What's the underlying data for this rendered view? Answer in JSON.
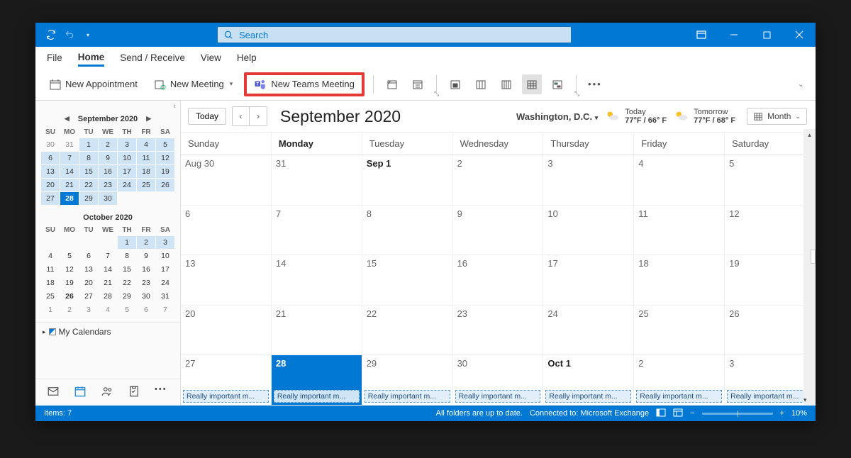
{
  "titlebar": {
    "search_placeholder": "Search"
  },
  "menu": {
    "file": "File",
    "home": "Home",
    "send_receive": "Send / Receive",
    "view": "View",
    "help": "Help"
  },
  "ribbon": {
    "new_appointment": "New Appointment",
    "new_meeting": "New Meeting",
    "new_teams_meeting": "New Teams Meeting"
  },
  "sidebar": {
    "minical1": {
      "title": "September 2020",
      "dow": [
        "SU",
        "MO",
        "TU",
        "WE",
        "TH",
        "FR",
        "SA"
      ],
      "days": [
        {
          "n": "30"
        },
        {
          "n": "31"
        },
        {
          "n": "1",
          "cm": true,
          "r": true
        },
        {
          "n": "2",
          "cm": true,
          "r": true
        },
        {
          "n": "3",
          "cm": true,
          "r": true
        },
        {
          "n": "4",
          "cm": true,
          "r": true
        },
        {
          "n": "5",
          "cm": true,
          "r": true
        },
        {
          "n": "6",
          "cm": true,
          "r": true
        },
        {
          "n": "7",
          "cm": true,
          "r": true
        },
        {
          "n": "8",
          "cm": true,
          "r": true
        },
        {
          "n": "9",
          "cm": true,
          "r": true
        },
        {
          "n": "10",
          "cm": true,
          "r": true
        },
        {
          "n": "11",
          "cm": true,
          "r": true
        },
        {
          "n": "12",
          "cm": true,
          "r": true
        },
        {
          "n": "13",
          "cm": true,
          "r": true
        },
        {
          "n": "14",
          "cm": true,
          "r": true
        },
        {
          "n": "15",
          "cm": true,
          "r": true
        },
        {
          "n": "16",
          "cm": true,
          "r": true
        },
        {
          "n": "17",
          "cm": true,
          "r": true
        },
        {
          "n": "18",
          "cm": true,
          "r": true
        },
        {
          "n": "19",
          "cm": true,
          "r": true
        },
        {
          "n": "20",
          "cm": true,
          "r": true
        },
        {
          "n": "21",
          "cm": true,
          "r": true
        },
        {
          "n": "22",
          "cm": true,
          "r": true
        },
        {
          "n": "23",
          "cm": true,
          "r": true
        },
        {
          "n": "24",
          "cm": true,
          "r": true
        },
        {
          "n": "25",
          "cm": true,
          "r": true
        },
        {
          "n": "26",
          "cm": true,
          "r": true
        },
        {
          "n": "27",
          "cm": true,
          "r": true
        },
        {
          "n": "28",
          "cm": true,
          "today": true
        },
        {
          "n": "29",
          "cm": true,
          "r": true
        },
        {
          "n": "30",
          "cm": true,
          "r": true
        },
        {
          "n": ""
        },
        {
          "n": ""
        },
        {
          "n": ""
        }
      ]
    },
    "minical2": {
      "title": "October 2020",
      "dow": [
        "SU",
        "MO",
        "TU",
        "WE",
        "TH",
        "FR",
        "SA"
      ],
      "days": [
        {
          "n": ""
        },
        {
          "n": ""
        },
        {
          "n": ""
        },
        {
          "n": ""
        },
        {
          "n": "1",
          "cm": true,
          "r": true
        },
        {
          "n": "2",
          "cm": true,
          "r": true
        },
        {
          "n": "3",
          "cm": true,
          "r": true
        },
        {
          "n": "4",
          "cm": true
        },
        {
          "n": "5",
          "cm": true
        },
        {
          "n": "6",
          "cm": true
        },
        {
          "n": "7",
          "cm": true
        },
        {
          "n": "8",
          "cm": true
        },
        {
          "n": "9",
          "cm": true
        },
        {
          "n": "10",
          "cm": true
        },
        {
          "n": "11",
          "cm": true
        },
        {
          "n": "12",
          "cm": true
        },
        {
          "n": "13",
          "cm": true
        },
        {
          "n": "14",
          "cm": true
        },
        {
          "n": "15",
          "cm": true
        },
        {
          "n": "16",
          "cm": true
        },
        {
          "n": "17",
          "cm": true
        },
        {
          "n": "18",
          "cm": true
        },
        {
          "n": "19",
          "cm": true
        },
        {
          "n": "20",
          "cm": true
        },
        {
          "n": "21",
          "cm": true
        },
        {
          "n": "22",
          "cm": true
        },
        {
          "n": "23",
          "cm": true
        },
        {
          "n": "24",
          "cm": true
        },
        {
          "n": "25",
          "cm": true
        },
        {
          "n": "26",
          "cm": true,
          "bold": true
        },
        {
          "n": "27",
          "cm": true
        },
        {
          "n": "28",
          "cm": true
        },
        {
          "n": "29",
          "cm": true
        },
        {
          "n": "30",
          "cm": true
        },
        {
          "n": "31",
          "cm": true
        },
        {
          "n": "1"
        },
        {
          "n": "2"
        },
        {
          "n": "3"
        },
        {
          "n": "4"
        },
        {
          "n": "5"
        },
        {
          "n": "6"
        },
        {
          "n": "7"
        }
      ]
    },
    "my_calendars": "My Calendars"
  },
  "cal_header": {
    "today_btn": "Today",
    "title": "September 2020",
    "location": "Washington, D.C.",
    "weather1_label": "Today",
    "weather1_temp": "77°F / 66° F",
    "weather2_label": "Tomorrow",
    "weather2_temp": "77°F / 68° F",
    "view_label": "Month"
  },
  "dow": [
    "Sunday",
    "Monday",
    "Tuesday",
    "Wednesday",
    "Thursday",
    "Friday",
    "Saturday"
  ],
  "dow_bold_index": 1,
  "grid": [
    [
      {
        "n": "Aug 30"
      },
      {
        "n": "31"
      },
      {
        "n": "Sep 1",
        "b": true
      },
      {
        "n": "2"
      },
      {
        "n": "3"
      },
      {
        "n": "4"
      },
      {
        "n": "5"
      }
    ],
    [
      {
        "n": "6"
      },
      {
        "n": "7"
      },
      {
        "n": "8"
      },
      {
        "n": "9"
      },
      {
        "n": "10"
      },
      {
        "n": "11"
      },
      {
        "n": "12"
      }
    ],
    [
      {
        "n": "13"
      },
      {
        "n": "14"
      },
      {
        "n": "15"
      },
      {
        "n": "16"
      },
      {
        "n": "17"
      },
      {
        "n": "18"
      },
      {
        "n": "19"
      }
    ],
    [
      {
        "n": "20"
      },
      {
        "n": "21"
      },
      {
        "n": "22"
      },
      {
        "n": "23"
      },
      {
        "n": "24"
      },
      {
        "n": "25"
      },
      {
        "n": "26"
      }
    ],
    [
      {
        "n": "27",
        "e": "Really important m..."
      },
      {
        "n": "28",
        "e": "Really important m...",
        "today": true
      },
      {
        "n": "29",
        "e": "Really important m..."
      },
      {
        "n": "30",
        "e": "Really important m..."
      },
      {
        "n": "Oct 1",
        "e": "Really important m...",
        "b": true
      },
      {
        "n": "2",
        "e": "Really important m..."
      },
      {
        "n": "3",
        "e": "Really important m..."
      }
    ]
  ],
  "status": {
    "items": "Items: 7",
    "sync": "All folders are up to date.",
    "conn": "Connected to: Microsoft Exchange",
    "zoom": "10%"
  }
}
